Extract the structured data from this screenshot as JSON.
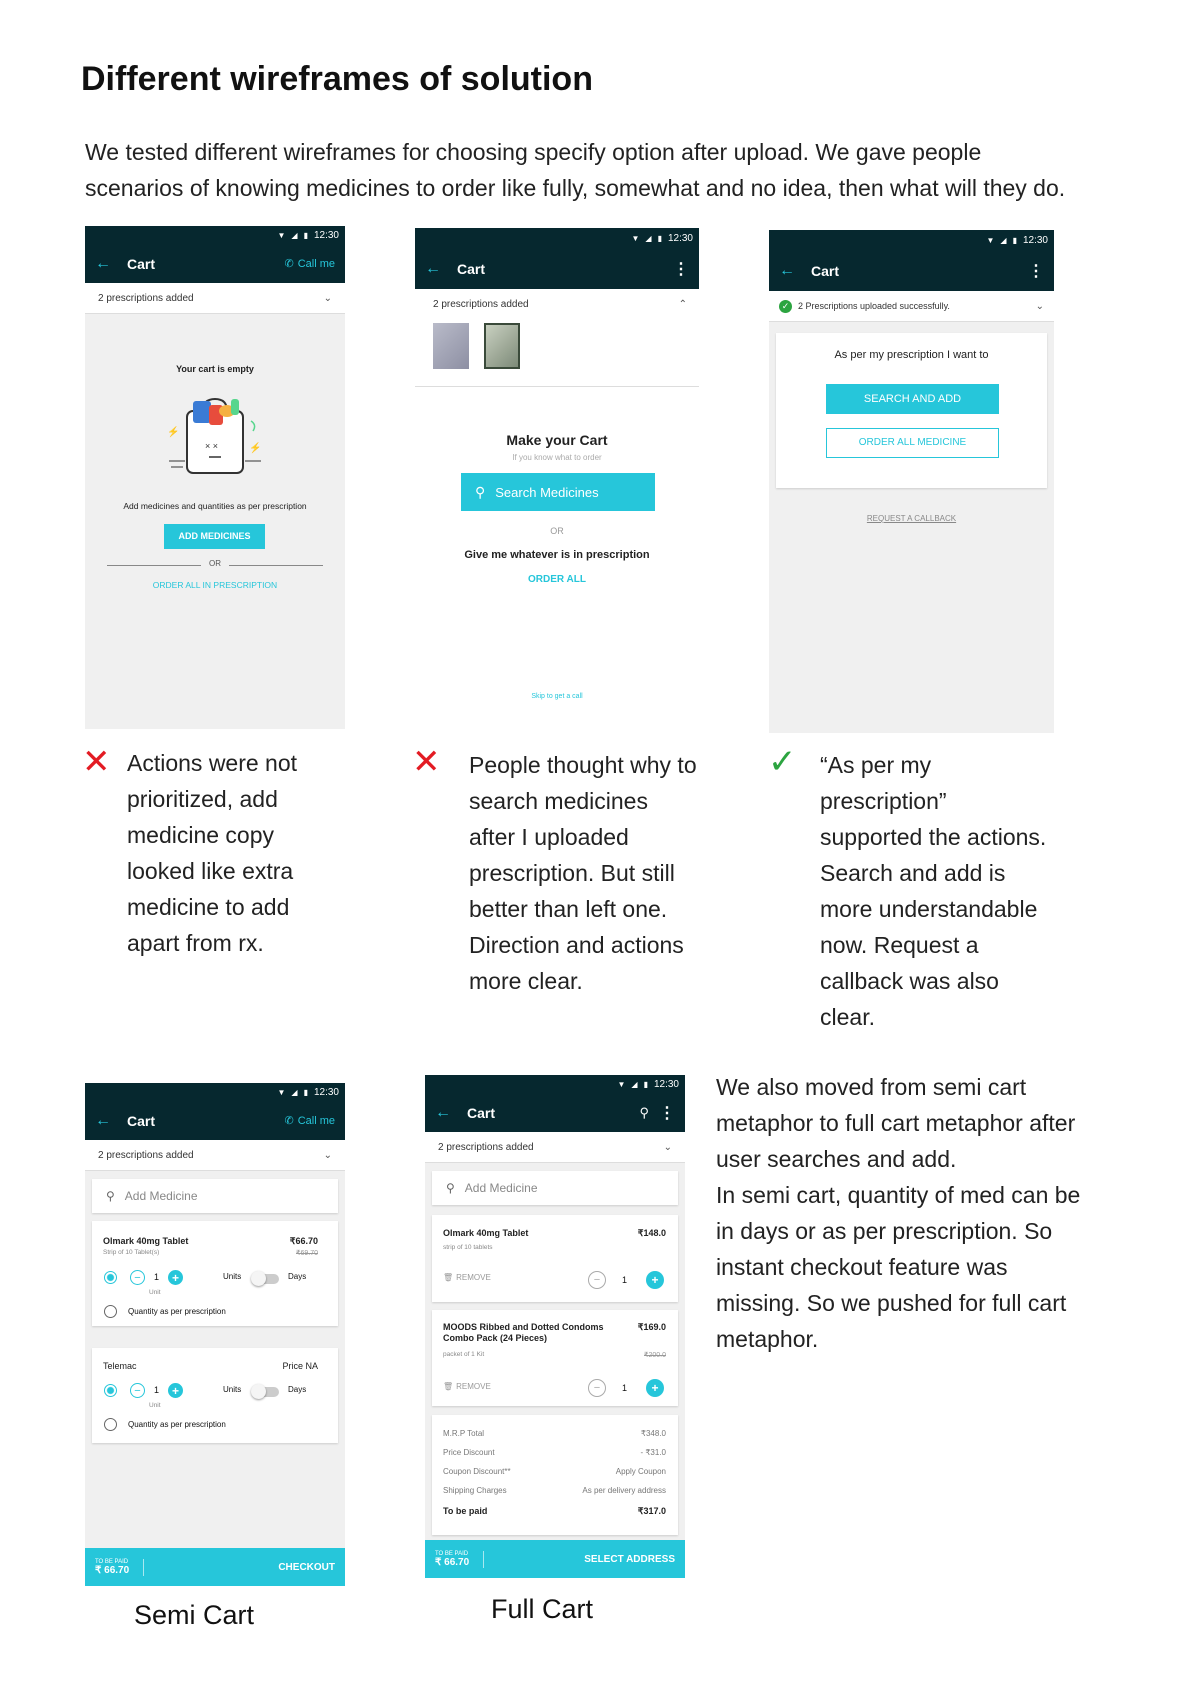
{
  "heading": "Different wireframes of solution",
  "intro": [
    "We tested different wireframes for choosing specify option after upload. We gave people",
    "scenarios of knowing medicines to order like fully, somewhat and no idea, then what will they do."
  ],
  "common": {
    "time": "12:30",
    "cart_title": "Cart",
    "call_me": "Call me",
    "back_arrow": "←",
    "more": "⋮",
    "chevron_down": "⌄",
    "chevron_up": "⌃"
  },
  "wf1": {
    "rx_bar": "2 prescriptions added",
    "empty_title": "Your cart is empty",
    "hint": "Add medicines and quantities as per prescription",
    "add_btn": "ADD MEDICINES",
    "or": "OR",
    "order_all": "ORDER ALL IN PRESCRIPTION"
  },
  "wf2": {
    "rx_bar": "2 prescriptions added",
    "make_title": "Make your Cart",
    "make_sub": "If you know what to order",
    "search_btn": "Search Medicines",
    "or": "OR",
    "give_me": "Give me whatever is in prescription",
    "order_all": "ORDER ALL",
    "skip": "Skip to get a call"
  },
  "wf3": {
    "rx_bar": "2 Prescriptions uploaded successfully.",
    "as_per": "As per my prescription I want to",
    "search_add": "SEARCH AND ADD",
    "order_all": "ORDER ALL MEDICINE",
    "callback": "REQUEST A CALLBACK"
  },
  "verdicts": {
    "v1": {
      "icon": "✕",
      "lines": [
        "Actions were not",
        "prioritized, add",
        "medicine copy",
        "looked like extra",
        "medicine to add",
        "apart from rx."
      ]
    },
    "v2": {
      "icon": "✕",
      "lines": [
        "People thought why to",
        "search medicines",
        "after I uploaded",
        "prescription. But still",
        "better than left one.",
        "Direction and actions",
        "more clear."
      ]
    },
    "v3": {
      "icon": "✓",
      "lines": [
        "“As per my",
        "prescription”",
        "supported the actions.",
        "Search and add is",
        "more understandable",
        "now. Request a",
        "callback was also",
        "clear."
      ]
    }
  },
  "semi": {
    "rx_bar": "2 prescriptions added",
    "search_placeholder": "Add Medicine",
    "items": [
      {
        "name": "Olmark 40mg Tablet",
        "sub": "Strip of 10 Tablet(s)",
        "price": "₹66.70",
        "mrp": "₹69.70",
        "qty": "1",
        "unit": "Unit",
        "units": "Units",
        "days": "Days",
        "as_per": "Quantity as per prescription"
      },
      {
        "name": "Telemac",
        "sub": "",
        "price": "Price NA",
        "mrp": "",
        "qty": "1",
        "unit": "Unit",
        "units": "Units",
        "days": "Days",
        "as_per": "Quantity as per prescription"
      }
    ],
    "to_be_paid_label": "TO BE PAID",
    "to_be_paid": "₹ 66.70",
    "checkout": "CHECKOUT",
    "caption": "Semi Cart"
  },
  "full": {
    "rx_bar": "2 prescriptions added",
    "search_placeholder": "Add Medicine",
    "items": [
      {
        "name": "Olmark 40mg Tablet",
        "sub": "strip of 10 tablets",
        "price": "₹148.0",
        "mrp": "",
        "qty": "1",
        "remove": "REMOVE"
      },
      {
        "name": "MOODS Ribbed and Dotted Condoms Combo Pack (24 Pieces)",
        "sub": "packet of 1 Kit",
        "price": "₹169.0",
        "mrp": "₹200.0",
        "qty": "1",
        "remove": "REMOVE"
      }
    ],
    "summary": [
      {
        "label": "M.R.P Total",
        "value": "₹348.0"
      },
      {
        "label": "Price Discount",
        "value": "- ₹31.0"
      },
      {
        "label": "Coupon Discount**",
        "value": "Apply Coupon"
      },
      {
        "label": "Shipping Charges",
        "value": "As per delivery address"
      }
    ],
    "total_label": "To be paid",
    "total_value": "₹317.0",
    "to_be_paid_label": "TO BE PAID",
    "to_be_paid": "₹ 66.70",
    "select_address": "SELECT ADDRESS",
    "caption": "Full Cart"
  },
  "side_text": [
    "We also moved from semi cart",
    "metaphor to full cart metaphor after",
    "user searches and add.",
    "In semi cart, quantity of med can be",
    "in days or as per prescription. So",
    "instant checkout feature was",
    "missing. So we pushed for full cart",
    "metaphor."
  ],
  "colors": {
    "dark_bar": "#06282f",
    "teal": "#26c6da",
    "red_x": "#e31b23",
    "green_check": "#2ca440"
  },
  "icons": [
    "back-arrow-icon",
    "phone-icon",
    "more-icon",
    "chevron-down-icon",
    "chevron-up-icon",
    "search-icon",
    "check-circle-icon",
    "cross-icon",
    "checkmark-icon",
    "trash-icon",
    "minus-icon",
    "plus-icon",
    "empty-bag-illustration",
    "wifi-icon",
    "signal-icon",
    "battery-icon"
  ]
}
